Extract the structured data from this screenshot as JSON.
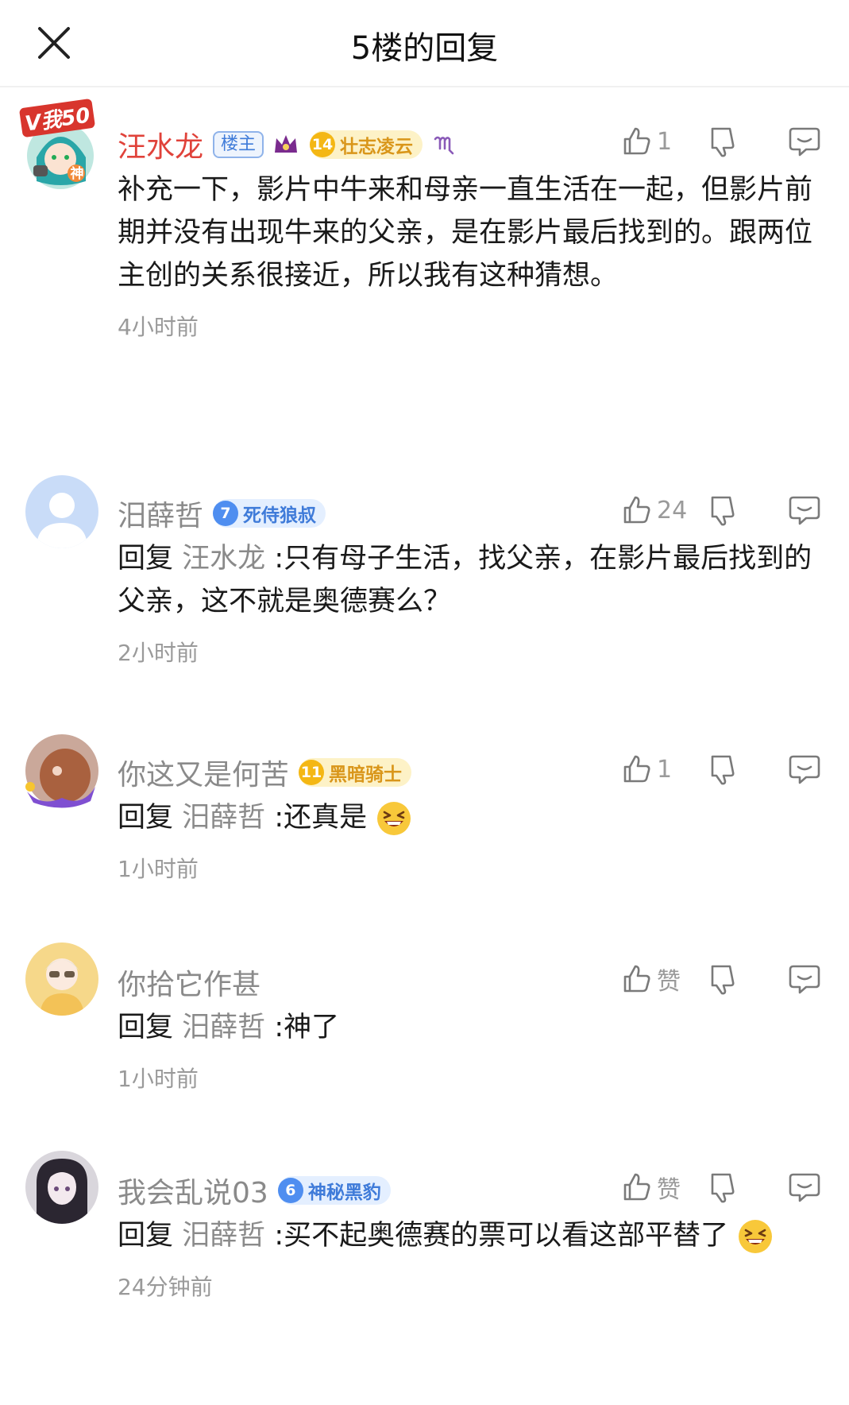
{
  "header": {
    "title": "5楼的回复"
  },
  "comments": [
    {
      "username": "汪水龙",
      "owner_badge": "楼主",
      "level": "14",
      "level_title": "壮志凌云",
      "likes": "1",
      "content": "补充一下，影片中牛来和母亲一直生活在一起，但影片前期并没有出现牛来的父亲，是在影片最后找到的。跟两位主创的关系很接近，所以我有这种猜想。",
      "time": "4小时前"
    },
    {
      "username": "汨薛哲",
      "level": "7",
      "level_title": "死侍狼叔",
      "likes": "24",
      "reply_prefix": "回复",
      "reply_target": "汪水龙",
      "content": ":只有母子生活，找父亲，在影片最后找到的父亲，这不就是奥德赛么？",
      "time": "2小时前"
    },
    {
      "username": "你这又是何苦",
      "level": "11",
      "level_title": "黑暗骑士",
      "likes": "1",
      "reply_prefix": "回复",
      "reply_target": "汨薛哲",
      "content": ":还真是",
      "time": "1小时前"
    },
    {
      "username": "你拾它作甚",
      "likes": "赞",
      "reply_prefix": "回复",
      "reply_target": "汨薛哲",
      "content": ":神了",
      "time": "1小时前"
    },
    {
      "username": "我会乱说03",
      "level": "6",
      "level_title": "神秘黑豹",
      "likes": "赞",
      "reply_prefix": "回复",
      "reply_target": "汨薛哲",
      "content": ":买不起奥德赛的票可以看这部平替了",
      "time": "24分钟前"
    }
  ],
  "avatar_overlay": {
    "vip_text": "V我50",
    "god_text": "神"
  },
  "icons": {
    "close": "close-icon",
    "like": "thumbs-up-icon",
    "dislike": "thumbs-down-icon",
    "reply": "comment-bubble-icon",
    "emoji": "grinning-squint-emoji"
  },
  "colors": {
    "owner_name": "#e0423a",
    "meta_text": "#9a9a9a",
    "gold_badge": "#f4b714",
    "blue_badge": "#4f8ef0"
  }
}
